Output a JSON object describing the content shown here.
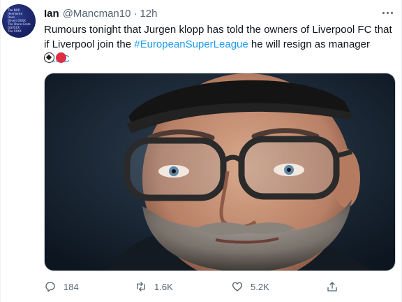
{
  "tweet": {
    "author_name": "Ian",
    "handle": "@Mancman10",
    "separator": "·",
    "time": "12h",
    "avatar_text": [
      "The NOR",
      "Heartwrite",
      "Does",
      "Olive'e'XXXX",
      "The Stone Grate",
      "GGVXXX",
      "The XXXX"
    ],
    "text_before": "Rumours tonight that Jurgen klopp has told the owners of Liverpool FC that if Liverpool join the ",
    "hashtag_esl": "#EuropeanSuperLeague",
    "text_middle": " he will resign as manager ",
    "hashtag_lfc": "#LFC",
    "emojis": [
      "soccer-ball",
      "red-circle"
    ]
  },
  "actions": {
    "reply_count": "184",
    "retweet_count": "1.6K",
    "like_count": "5.2K"
  },
  "colors": {
    "accent": "#1d9bf0",
    "muted": "#536471",
    "text": "#0f1419"
  }
}
